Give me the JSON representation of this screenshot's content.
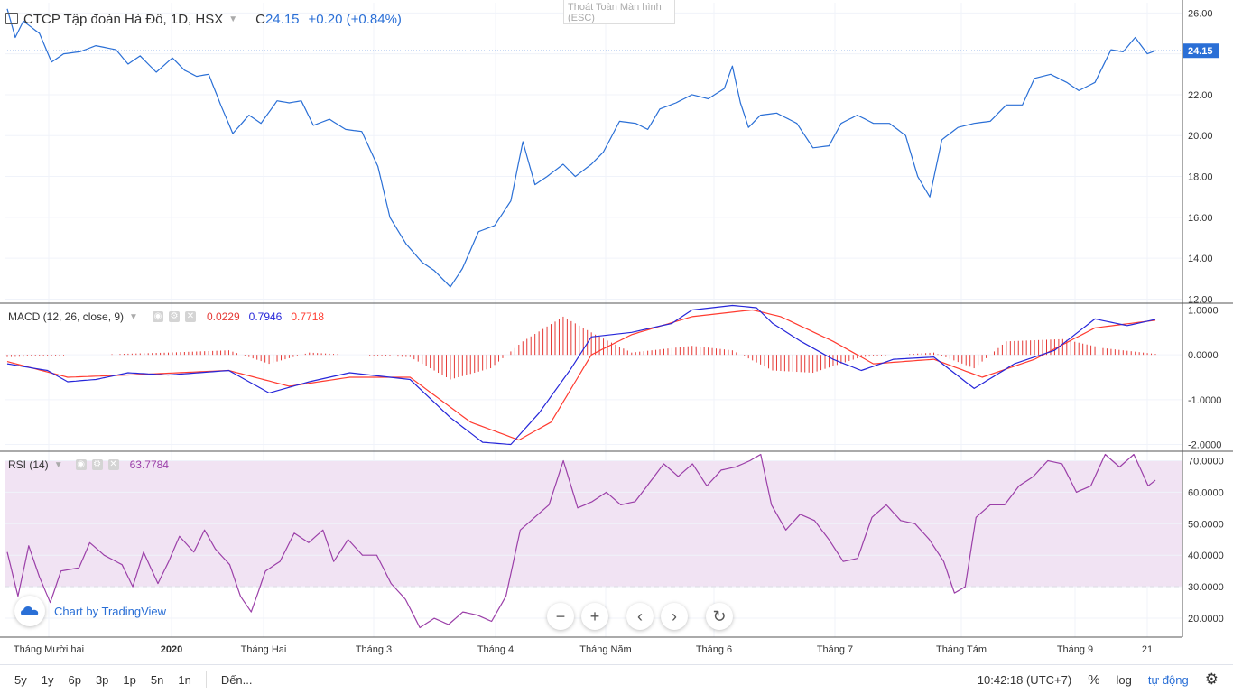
{
  "header": {
    "symbol": "CTCP Tập đoàn Hà Đô, 1D, HSX",
    "ohlc_prefix": "C",
    "last": "24.15",
    "change": "+0.20 (+0.84%)",
    "fullscreen_hint_line1": "Thoát Toàn Màn hình",
    "fullscreen_hint_line2": "(ESC)"
  },
  "indicators": {
    "macd": {
      "title": "MACD (12, 26, close, 9)",
      "hist": "0.0229",
      "macd": "0.7946",
      "signal": "0.7718"
    },
    "rsi": {
      "title": "RSI (14)",
      "value": "63.7784"
    }
  },
  "branding": {
    "text": "Chart by TradingView"
  },
  "toolbar": {
    "periods": [
      "5y",
      "1y",
      "6p",
      "3p",
      "1p",
      "5n",
      "1n"
    ],
    "goto": "Đến...",
    "time": "10:42:18 (UTC+7)",
    "percent": "%",
    "log": "log",
    "auto": "tự động"
  },
  "colors": {
    "price": "#2a6fd6",
    "macd": "#2626d9",
    "signal": "#ff3b30",
    "histogram": "#e53935",
    "rsi": "#9b3fa8",
    "rsi_band": "#f1e3f3"
  },
  "chart_data": [
    {
      "type": "line",
      "name": "price",
      "ylim": [
        11.8,
        26.5
      ],
      "yticks": [
        "26.00",
        "24.00",
        "22.00",
        "20.00",
        "18.00",
        "16.00",
        "14.00",
        "12.00"
      ],
      "last_value_label": "24.15",
      "x_tick_labels": [
        "Tháng Mười hai",
        "2020",
        "Tháng Hai",
        "Tháng 3",
        "Tháng 4",
        "Tháng Năm",
        "Tháng 6",
        "Tháng 7",
        "Tháng Tám",
        "Tháng 9",
        "21"
      ],
      "keypoints": [
        [
          0,
          26.2
        ],
        [
          2,
          24.8
        ],
        [
          4,
          25.6
        ],
        [
          8,
          25.0
        ],
        [
          11,
          23.6
        ],
        [
          14,
          24.0
        ],
        [
          18,
          24.1
        ],
        [
          22,
          24.4
        ],
        [
          27,
          24.2
        ],
        [
          30,
          23.5
        ],
        [
          33,
          23.9
        ],
        [
          37,
          23.1
        ],
        [
          41,
          23.8
        ],
        [
          44,
          23.2
        ],
        [
          47,
          22.9
        ],
        [
          50,
          23.0
        ],
        [
          53,
          21.5
        ],
        [
          56,
          20.1
        ],
        [
          60,
          21.0
        ],
        [
          63,
          20.6
        ],
        [
          67,
          21.7
        ],
        [
          70,
          21.6
        ],
        [
          73,
          21.7
        ],
        [
          76,
          20.5
        ],
        [
          80,
          20.8
        ],
        [
          84,
          20.3
        ],
        [
          88,
          20.2
        ],
        [
          92,
          18.5
        ],
        [
          95,
          16.0
        ],
        [
          99,
          14.7
        ],
        [
          103,
          13.8
        ],
        [
          106,
          13.4
        ],
        [
          110,
          12.6
        ],
        [
          113,
          13.5
        ],
        [
          117,
          15.3
        ],
        [
          121,
          15.6
        ],
        [
          125,
          16.8
        ],
        [
          128,
          19.7
        ],
        [
          131,
          17.6
        ],
        [
          134,
          18.0
        ],
        [
          138,
          18.6
        ],
        [
          141,
          18.0
        ],
        [
          145,
          18.6
        ],
        [
          148,
          19.2
        ],
        [
          152,
          20.7
        ],
        [
          156,
          20.6
        ],
        [
          159,
          20.3
        ],
        [
          162,
          21.3
        ],
        [
          166,
          21.6
        ],
        [
          170,
          22.0
        ],
        [
          174,
          21.8
        ],
        [
          178,
          22.3
        ],
        [
          180,
          23.4
        ],
        [
          182,
          21.6
        ],
        [
          184,
          20.4
        ],
        [
          187,
          21.0
        ],
        [
          191,
          21.1
        ],
        [
          196,
          20.6
        ],
        [
          200,
          19.4
        ],
        [
          204,
          19.5
        ],
        [
          207,
          20.6
        ],
        [
          211,
          21.0
        ],
        [
          215,
          20.6
        ],
        [
          219,
          20.6
        ],
        [
          223,
          20.0
        ],
        [
          226,
          18.0
        ],
        [
          229,
          17.0
        ],
        [
          232,
          19.8
        ],
        [
          236,
          20.4
        ],
        [
          240,
          20.6
        ],
        [
          244,
          20.7
        ],
        [
          248,
          21.5
        ],
        [
          252,
          21.5
        ],
        [
          255,
          22.8
        ],
        [
          259,
          23.0
        ],
        [
          263,
          22.6
        ],
        [
          266,
          22.2
        ],
        [
          270,
          22.6
        ],
        [
          274,
          24.2
        ],
        [
          277,
          24.1
        ],
        [
          280,
          24.8
        ],
        [
          283,
          24.0
        ],
        [
          285,
          24.15
        ]
      ]
    },
    {
      "type": "line",
      "name": "macd",
      "ylim": [
        -2.15,
        1.15
      ],
      "yticks": [
        "1.0000",
        "0.0000",
        "-1.0000",
        "-2.0000"
      ],
      "series": [
        {
          "role": "macd",
          "keypoints": [
            [
              0,
              -0.2
            ],
            [
              10,
              -0.35
            ],
            [
              15,
              -0.6
            ],
            [
              22,
              -0.55
            ],
            [
              30,
              -0.4
            ],
            [
              40,
              -0.45
            ],
            [
              55,
              -0.35
            ],
            [
              65,
              -0.85
            ],
            [
              75,
              -0.6
            ],
            [
              85,
              -0.4
            ],
            [
              100,
              -0.55
            ],
            [
              110,
              -1.4
            ],
            [
              118,
              -1.95
            ],
            [
              125,
              -2.0
            ],
            [
              132,
              -1.3
            ],
            [
              140,
              -0.3
            ],
            [
              145,
              0.4
            ],
            [
              155,
              0.5
            ],
            [
              165,
              0.7
            ],
            [
              170,
              1.0
            ],
            [
              180,
              1.1
            ],
            [
              186,
              1.05
            ],
            [
              190,
              0.7
            ],
            [
              197,
              0.3
            ],
            [
              205,
              -0.1
            ],
            [
              212,
              -0.35
            ],
            [
              220,
              -0.1
            ],
            [
              230,
              -0.05
            ],
            [
              240,
              -0.75
            ],
            [
              250,
              -0.2
            ],
            [
              260,
              0.1
            ],
            [
              270,
              0.8
            ],
            [
              278,
              0.65
            ],
            [
              285,
              0.79
            ]
          ]
        },
        {
          "role": "signal",
          "keypoints": [
            [
              0,
              -0.15
            ],
            [
              15,
              -0.5
            ],
            [
              30,
              -0.45
            ],
            [
              55,
              -0.35
            ],
            [
              70,
              -0.7
            ],
            [
              85,
              -0.5
            ],
            [
              100,
              -0.5
            ],
            [
              115,
              -1.5
            ],
            [
              127,
              -1.9
            ],
            [
              135,
              -1.5
            ],
            [
              145,
              0.0
            ],
            [
              155,
              0.45
            ],
            [
              170,
              0.85
            ],
            [
              185,
              1.0
            ],
            [
              192,
              0.85
            ],
            [
              205,
              0.3
            ],
            [
              215,
              -0.2
            ],
            [
              230,
              -0.1
            ],
            [
              242,
              -0.5
            ],
            [
              255,
              -0.1
            ],
            [
              270,
              0.6
            ],
            [
              285,
              0.77
            ]
          ]
        }
      ],
      "histogram_keypoints": [
        [
          0,
          -0.05
        ],
        [
          20,
          0.0
        ],
        [
          40,
          0.05
        ],
        [
          55,
          0.1
        ],
        [
          65,
          -0.2
        ],
        [
          75,
          0.05
        ],
        [
          85,
          0.0
        ],
        [
          100,
          -0.05
        ],
        [
          110,
          -0.55
        ],
        [
          120,
          -0.3
        ],
        [
          128,
          0.3
        ],
        [
          138,
          0.85
        ],
        [
          146,
          0.45
        ],
        [
          155,
          0.05
        ],
        [
          170,
          0.2
        ],
        [
          180,
          0.1
        ],
        [
          190,
          -0.35
        ],
        [
          200,
          -0.4
        ],
        [
          212,
          -0.05
        ],
        [
          230,
          0.05
        ],
        [
          240,
          -0.3
        ],
        [
          248,
          0.3
        ],
        [
          262,
          0.35
        ],
        [
          272,
          0.15
        ],
        [
          285,
          0.02
        ]
      ]
    },
    {
      "type": "line",
      "name": "rsi",
      "ylim": [
        14,
        73
      ],
      "band": [
        30,
        70
      ],
      "yticks": [
        "70.0000",
        "60.0000",
        "50.0000",
        "40.0000",
        "30.0000",
        "20.0000"
      ],
      "keypoints": [
        [
          0,
          41
        ],
        [
          3,
          27
        ],
        [
          6,
          43
        ],
        [
          9,
          33
        ],
        [
          12,
          25
        ],
        [
          15,
          35
        ],
        [
          20,
          36
        ],
        [
          23,
          44
        ],
        [
          27,
          40
        ],
        [
          32,
          37
        ],
        [
          35,
          30
        ],
        [
          38,
          41
        ],
        [
          42,
          31
        ],
        [
          45,
          38
        ],
        [
          48,
          46
        ],
        [
          52,
          41
        ],
        [
          55,
          48
        ],
        [
          58,
          42
        ],
        [
          62,
          37
        ],
        [
          65,
          27
        ],
        [
          68,
          22
        ],
        [
          72,
          35
        ],
        [
          76,
          38
        ],
        [
          80,
          47
        ],
        [
          84,
          44
        ],
        [
          88,
          48
        ],
        [
          91,
          38
        ],
        [
          95,
          45
        ],
        [
          99,
          40
        ],
        [
          103,
          40
        ],
        [
          107,
          31
        ],
        [
          111,
          26
        ],
        [
          115,
          17
        ],
        [
          119,
          20
        ],
        [
          123,
          18
        ],
        [
          127,
          22
        ],
        [
          131,
          21
        ],
        [
          135,
          19
        ],
        [
          139,
          27
        ],
        [
          143,
          48
        ],
        [
          147,
          52
        ],
        [
          151,
          56
        ],
        [
          155,
          70
        ],
        [
          159,
          55
        ],
        [
          163,
          57
        ],
        [
          167,
          60
        ],
        [
          171,
          56
        ],
        [
          175,
          57
        ],
        [
          179,
          63
        ],
        [
          183,
          69
        ],
        [
          187,
          65
        ],
        [
          191,
          69
        ],
        [
          195,
          62
        ],
        [
          199,
          67
        ],
        [
          203,
          68
        ],
        [
          207,
          70
        ],
        [
          210,
          72
        ],
        [
          213,
          56
        ],
        [
          217,
          48
        ],
        [
          221,
          53
        ],
        [
          225,
          51
        ],
        [
          229,
          45
        ],
        [
          233,
          38
        ],
        [
          237,
          39
        ],
        [
          241,
          52
        ],
        [
          245,
          56
        ],
        [
          249,
          51
        ],
        [
          253,
          50
        ],
        [
          257,
          45
        ],
        [
          261,
          38
        ],
        [
          264,
          28
        ],
        [
          267,
          30
        ],
        [
          270,
          52
        ],
        [
          274,
          56
        ],
        [
          278,
          56
        ],
        [
          282,
          62
        ],
        [
          286,
          65
        ],
        [
          290,
          70
        ],
        [
          294,
          69
        ],
        [
          298,
          60
        ],
        [
          302,
          62
        ],
        [
          306,
          72
        ],
        [
          310,
          68
        ],
        [
          314,
          72
        ],
        [
          318,
          62
        ],
        [
          320,
          63.8
        ]
      ]
    }
  ]
}
